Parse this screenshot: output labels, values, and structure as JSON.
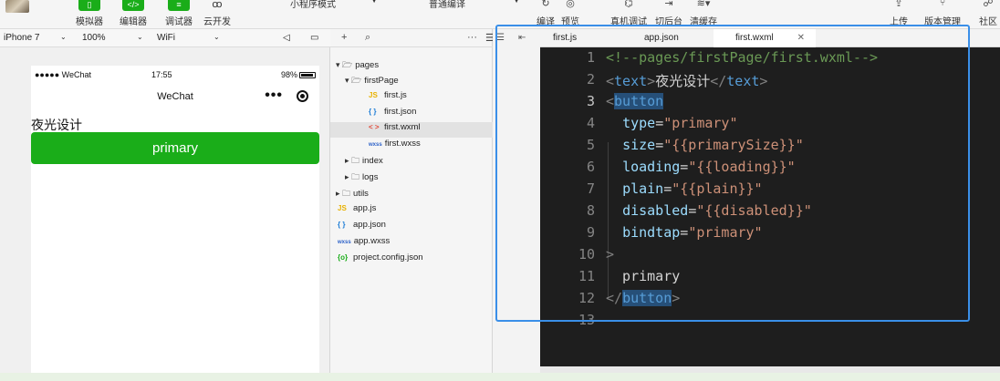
{
  "toolbar": {
    "simulator_label": "模拟器",
    "editor_label": "编辑器",
    "debugger_label": "调试器",
    "cloud_label": "云开发",
    "mode_select": "小程序模式",
    "compile_select": "普通编译",
    "compile_label": "编译",
    "preview_label": "预览",
    "realdebug_label": "真机调试",
    "background_label": "切后台",
    "clearcache_label": "清缓存",
    "upload_label": "上传",
    "version_label": "版本管理",
    "community_label": "社区"
  },
  "simulator": {
    "device": "iPhone 7",
    "zoom": "100%",
    "network": "WiFi",
    "status": {
      "signal": "●●●●● WeChat",
      "time": "17:55",
      "battery": "98%"
    },
    "nav_title": "WeChat",
    "text": "夜光设计",
    "button_label": "primary"
  },
  "tree": {
    "items": [
      {
        "label": "pages",
        "icon": "folder-open",
        "expanded": true
      },
      {
        "label": "firstPage",
        "icon": "folder-open",
        "expanded": true
      },
      {
        "label": "first.js",
        "icon": "JS"
      },
      {
        "label": "first.json",
        "icon": "{ }"
      },
      {
        "label": "first.wxml",
        "icon": "< >"
      },
      {
        "label": "first.wxss",
        "icon": "wxss"
      },
      {
        "label": "index",
        "icon": "folder",
        "expanded": false
      },
      {
        "label": "logs",
        "icon": "folder",
        "expanded": false
      },
      {
        "label": "utils",
        "icon": "folder",
        "expanded": false
      },
      {
        "label": "app.js",
        "icon": "JS"
      },
      {
        "label": "app.json",
        "icon": "{ }"
      },
      {
        "label": "app.wxss",
        "icon": "wxss"
      },
      {
        "label": "project.config.json",
        "icon": "{o}"
      }
    ],
    "active": "first.wxml"
  },
  "editor": {
    "tabs": [
      "first.js",
      "app.json",
      "first.wxml"
    ],
    "active_tab": "first.wxml",
    "lines": [
      "<!--pages/firstPage/first.wxml-->",
      "<text>夜光设计</text>",
      "<button",
      "  type=\"primary\"",
      "  size=\"{{primarySize}}\"",
      "  loading=\"{{loading}}\"",
      "  plain=\"{{plain}}\"",
      "  disabled=\"{{disabled}}\"",
      "  bindtap=\"primary\"",
      ">",
      "  primary",
      "</button>",
      ""
    ],
    "current_line": 3
  },
  "colors": {
    "accent": "#1aad19",
    "highlight": "#3a8fe8",
    "editor_bg": "#1e1e1e"
  }
}
